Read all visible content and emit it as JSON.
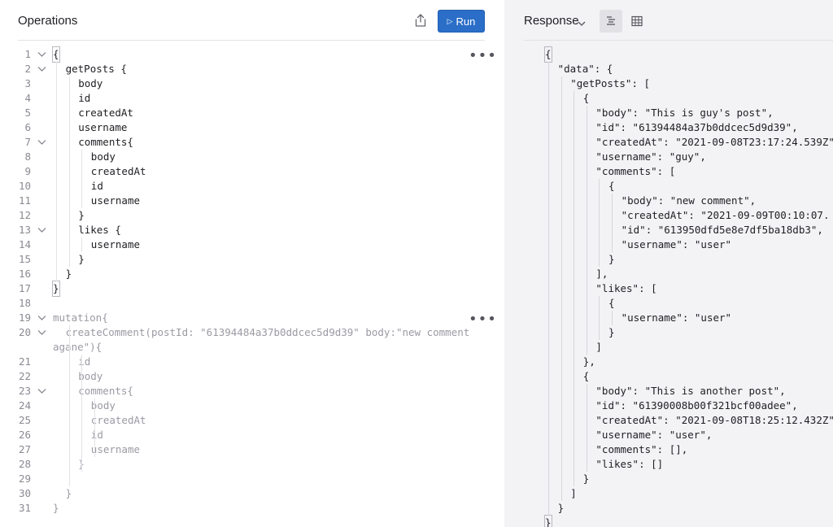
{
  "operations": {
    "title": "Operations",
    "run_label": "Run",
    "menu_glyph": "•••",
    "lines": [
      {
        "n": "1",
        "t": "{",
        "indent": 0,
        "fold": true,
        "dim": false
      },
      {
        "n": "2",
        "t": "getPosts {",
        "indent": 1,
        "fold": true,
        "dim": false
      },
      {
        "n": "3",
        "t": "body",
        "indent": 2,
        "fold": false,
        "dim": false
      },
      {
        "n": "4",
        "t": "id",
        "indent": 2,
        "fold": false,
        "dim": false
      },
      {
        "n": "5",
        "t": "createdAt",
        "indent": 2,
        "fold": false,
        "dim": false
      },
      {
        "n": "6",
        "t": "username",
        "indent": 2,
        "fold": false,
        "dim": false
      },
      {
        "n": "7",
        "t": "comments{",
        "indent": 2,
        "fold": true,
        "dim": false
      },
      {
        "n": "8",
        "t": "body",
        "indent": 3,
        "fold": false,
        "dim": false
      },
      {
        "n": "9",
        "t": "createdAt",
        "indent": 3,
        "fold": false,
        "dim": false
      },
      {
        "n": "10",
        "t": "id",
        "indent": 3,
        "fold": false,
        "dim": false
      },
      {
        "n": "11",
        "t": "username",
        "indent": 3,
        "fold": false,
        "dim": false
      },
      {
        "n": "12",
        "t": "}",
        "indent": 2,
        "fold": false,
        "dim": false
      },
      {
        "n": "13",
        "t": "likes {",
        "indent": 2,
        "fold": true,
        "dim": false
      },
      {
        "n": "14",
        "t": "username",
        "indent": 3,
        "fold": false,
        "dim": false
      },
      {
        "n": "15",
        "t": "}",
        "indent": 2,
        "fold": false,
        "dim": false
      },
      {
        "n": "16",
        "t": "}",
        "indent": 1,
        "fold": false,
        "dim": false
      },
      {
        "n": "17",
        "t": "}",
        "indent": 0,
        "fold": false,
        "dim": false
      },
      {
        "n": "18",
        "t": "",
        "indent": 0,
        "fold": false,
        "dim": false
      },
      {
        "n": "19",
        "t": "mutation{",
        "indent": 0,
        "fold": true,
        "dim": true
      },
      {
        "n": "20",
        "t": "createComment(postId: \"61394484a37b0ddcec5d9d39\" body:\"new comment",
        "indent": 1,
        "fold": true,
        "dim": true
      },
      {
        "n": "",
        "t": "agane\"){",
        "indent": 0,
        "fold": false,
        "dim": true
      },
      {
        "n": "21",
        "t": "id",
        "indent": 2,
        "fold": false,
        "dim": true
      },
      {
        "n": "22",
        "t": "body",
        "indent": 2,
        "fold": false,
        "dim": true
      },
      {
        "n": "23",
        "t": "comments{",
        "indent": 2,
        "fold": true,
        "dim": true
      },
      {
        "n": "24",
        "t": "body",
        "indent": 3,
        "fold": false,
        "dim": true
      },
      {
        "n": "25",
        "t": "createdAt",
        "indent": 3,
        "fold": false,
        "dim": true
      },
      {
        "n": "26",
        "t": "id",
        "indent": 3,
        "fold": false,
        "dim": true
      },
      {
        "n": "27",
        "t": "username",
        "indent": 3,
        "fold": false,
        "dim": true
      },
      {
        "n": "28",
        "t": "}",
        "indent": 2,
        "fold": false,
        "dim": true
      },
      {
        "n": "29",
        "t": "",
        "indent": 0,
        "fold": false,
        "dim": true
      },
      {
        "n": "30",
        "t": "}",
        "indent": 1,
        "fold": false,
        "dim": true
      },
      {
        "n": "31",
        "t": "}",
        "indent": 0,
        "fold": false,
        "dim": true
      }
    ]
  },
  "response": {
    "title": "Response",
    "lines": [
      {
        "t": "{",
        "indent": 0
      },
      {
        "t": "\"data\": {",
        "indent": 1
      },
      {
        "t": "\"getPosts\": [",
        "indent": 2
      },
      {
        "t": "{",
        "indent": 3
      },
      {
        "t": "\"body\": \"This is guy's post\",",
        "indent": 4
      },
      {
        "t": "\"id\": \"61394484a37b0ddcec5d9d39\",",
        "indent": 4
      },
      {
        "t": "\"createdAt\": \"2021-09-08T23:17:24.539Z\",",
        "indent": 4
      },
      {
        "t": "\"username\": \"guy\",",
        "indent": 4
      },
      {
        "t": "\"comments\": [",
        "indent": 4
      },
      {
        "t": "{",
        "indent": 5
      },
      {
        "t": "\"body\": \"new comment\",",
        "indent": 6
      },
      {
        "t": "\"createdAt\": \"2021-09-09T00:10:07.",
        "indent": 6
      },
      {
        "t": "\"id\": \"613950dfd5e8e7df5ba18db3\",",
        "indent": 6
      },
      {
        "t": "\"username\": \"user\"",
        "indent": 6
      },
      {
        "t": "}",
        "indent": 5
      },
      {
        "t": "],",
        "indent": 4
      },
      {
        "t": "\"likes\": [",
        "indent": 4
      },
      {
        "t": "{",
        "indent": 5
      },
      {
        "t": "\"username\": \"user\"",
        "indent": 6
      },
      {
        "t": "}",
        "indent": 5
      },
      {
        "t": "]",
        "indent": 4
      },
      {
        "t": "},",
        "indent": 3
      },
      {
        "t": "{",
        "indent": 3
      },
      {
        "t": "\"body\": \"This is another post\",",
        "indent": 4
      },
      {
        "t": "\"id\": \"61390008b00f321bcf00adee\",",
        "indent": 4
      },
      {
        "t": "\"createdAt\": \"2021-09-08T18:25:12.432Z\",",
        "indent": 4
      },
      {
        "t": "\"username\": \"user\",",
        "indent": 4
      },
      {
        "t": "\"comments\": [],",
        "indent": 4
      },
      {
        "t": "\"likes\": []",
        "indent": 4
      },
      {
        "t": "}",
        "indent": 3
      },
      {
        "t": "]",
        "indent": 2
      },
      {
        "t": "}",
        "indent": 1
      },
      {
        "t": "}",
        "indent": 0
      }
    ]
  },
  "colors": {
    "run_button": "#2a6ec8",
    "panel_left": "#ffffff",
    "panel_right": "#f3f3f5"
  }
}
